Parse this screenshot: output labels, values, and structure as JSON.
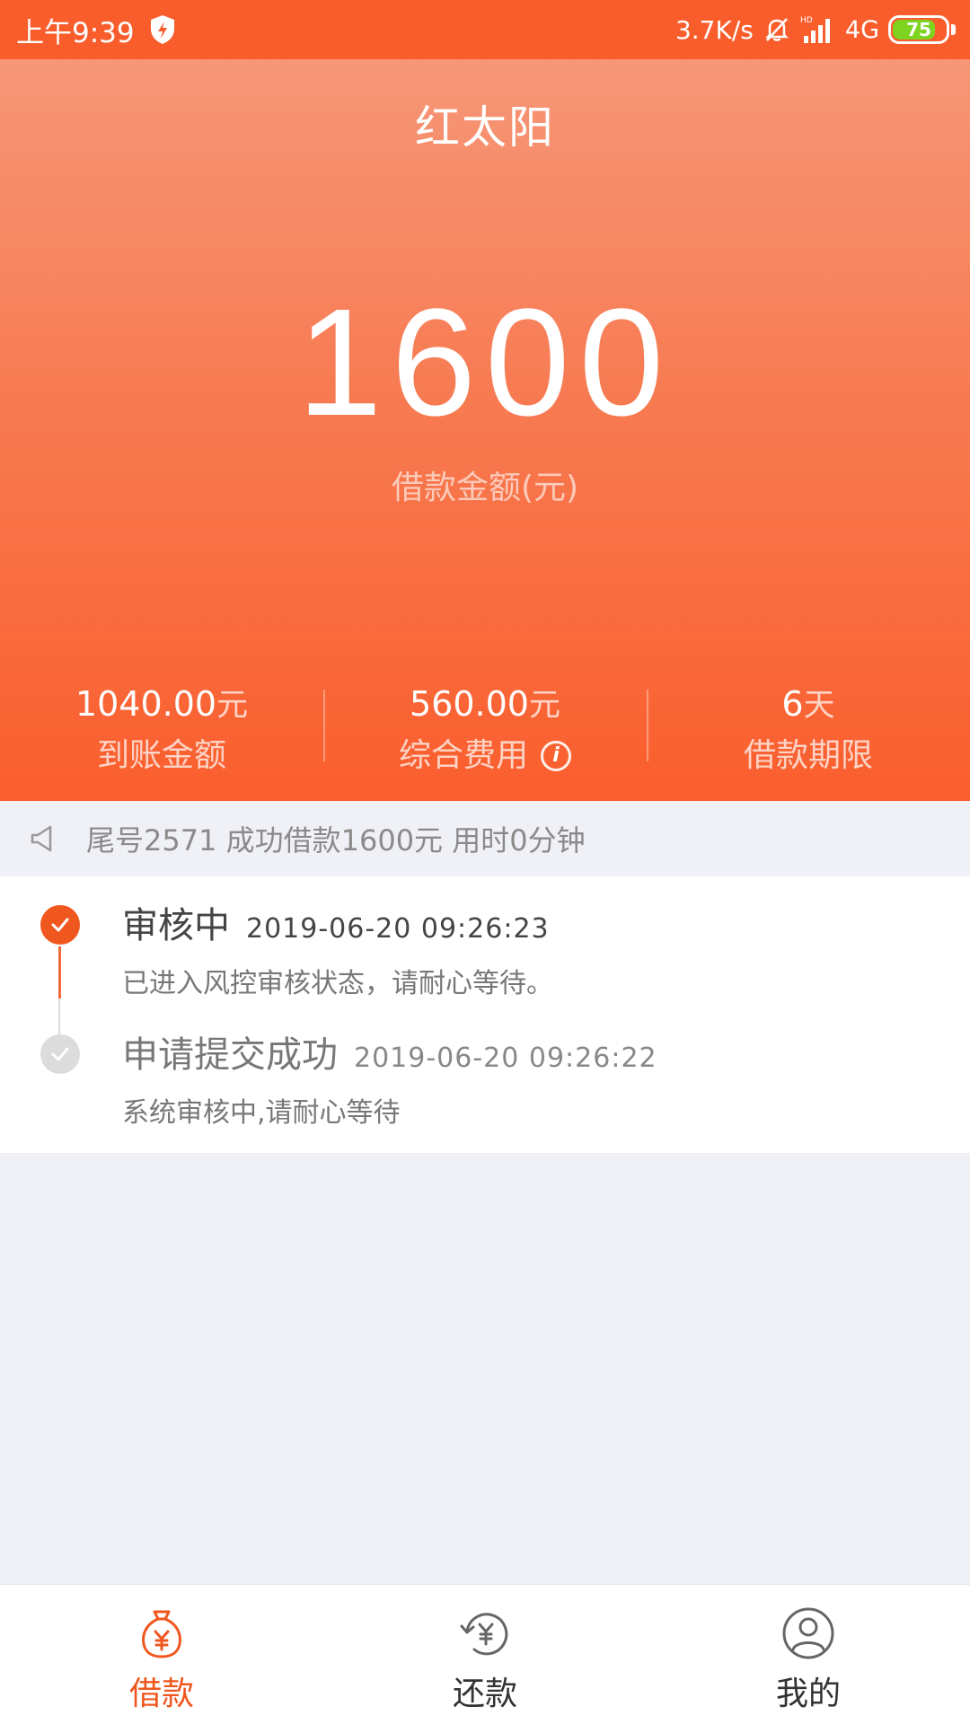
{
  "status_bar": {
    "time": "上午9:39",
    "speed": "3.7K/s",
    "network": "4G",
    "battery": "75"
  },
  "header": {
    "title": "红太阳"
  },
  "loan": {
    "amount": "1600",
    "amount_label": "借款金额(元)"
  },
  "stats": [
    {
      "value": "1040.00",
      "unit": "元",
      "label": "到账金额"
    },
    {
      "value": "560.00",
      "unit": "元",
      "label": "综合费用"
    },
    {
      "value": "6",
      "unit": "天",
      "label": "借款期限"
    }
  ],
  "notice": {
    "text": "尾号2571 成功借款1600元 用时0分钟"
  },
  "timeline": [
    {
      "title": "审核中",
      "time": "2019-06-20 09:26:23",
      "desc": "已进入风控审核状态，请耐心等待。"
    },
    {
      "title": "申请提交成功",
      "time": "2019-06-20 09:26:22",
      "desc": "系统审核中,请耐心等待"
    }
  ],
  "nav": [
    {
      "label": "借款",
      "icon": "money-bag-icon",
      "active": true
    },
    {
      "label": "还款",
      "icon": "repay-icon",
      "active": false
    },
    {
      "label": "我的",
      "icon": "profile-icon",
      "active": false
    }
  ],
  "colors": {
    "accent": "#f0571f",
    "status_bar": "#fa5d2c",
    "battery": "#7ed321"
  }
}
